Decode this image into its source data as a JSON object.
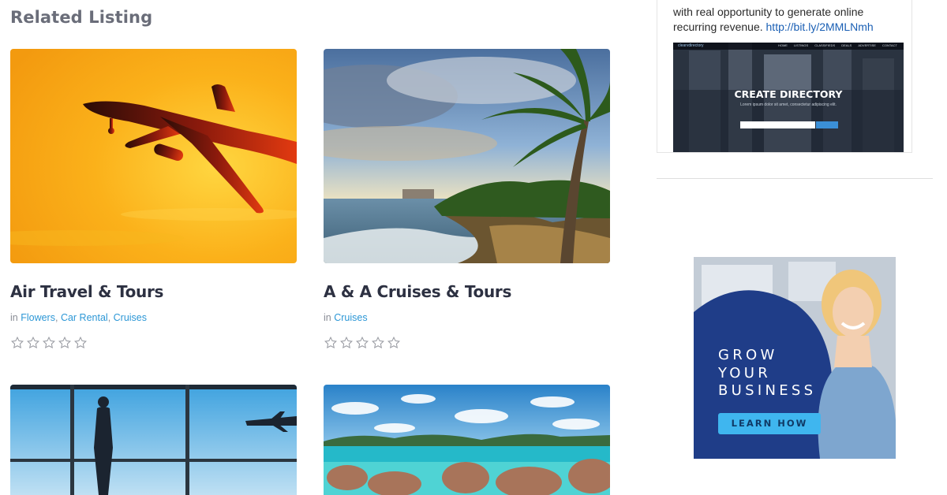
{
  "related": {
    "title": "Related Listing",
    "in_label": "in",
    "rating_stars": 0,
    "listings": [
      {
        "title": "Air Travel & Tours",
        "categories": [
          "Flowers",
          "Car Rental",
          "Cruises"
        ],
        "image": "airplane-sunset"
      },
      {
        "title": "A & A Cruises & Tours",
        "categories": [
          "Cruises"
        ],
        "image": "palm-beach"
      },
      {
        "image": "airport-window"
      },
      {
        "image": "tropical-rocks-beach"
      }
    ]
  },
  "sidebar": {
    "promo_text": "with real opportunity to generate online recurring revenue.",
    "promo_link": "http://bit.ly/2MMLNmh",
    "directory_preview": {
      "headline": "CREATE DIRECTORY",
      "sub": "Lorem ipsum dolor sit amet, consectetur adipiscing elit.",
      "nav_links": [
        "HOME",
        "LISTINGS",
        "CLASSIFIEDS",
        "DEALS",
        "ADVERTISE",
        "CONTACT"
      ],
      "logo": "clearvdirectory"
    },
    "ad": {
      "lines": [
        "GROW",
        "YOUR",
        "BUSINESS"
      ],
      "button": "LEARN HOW"
    }
  },
  "colors": {
    "link": "#2c97d6",
    "title": "#2d3142",
    "heading": "#6a6d79",
    "ad_blue": "#1e3c86",
    "ad_button": "#3fb6ef"
  }
}
